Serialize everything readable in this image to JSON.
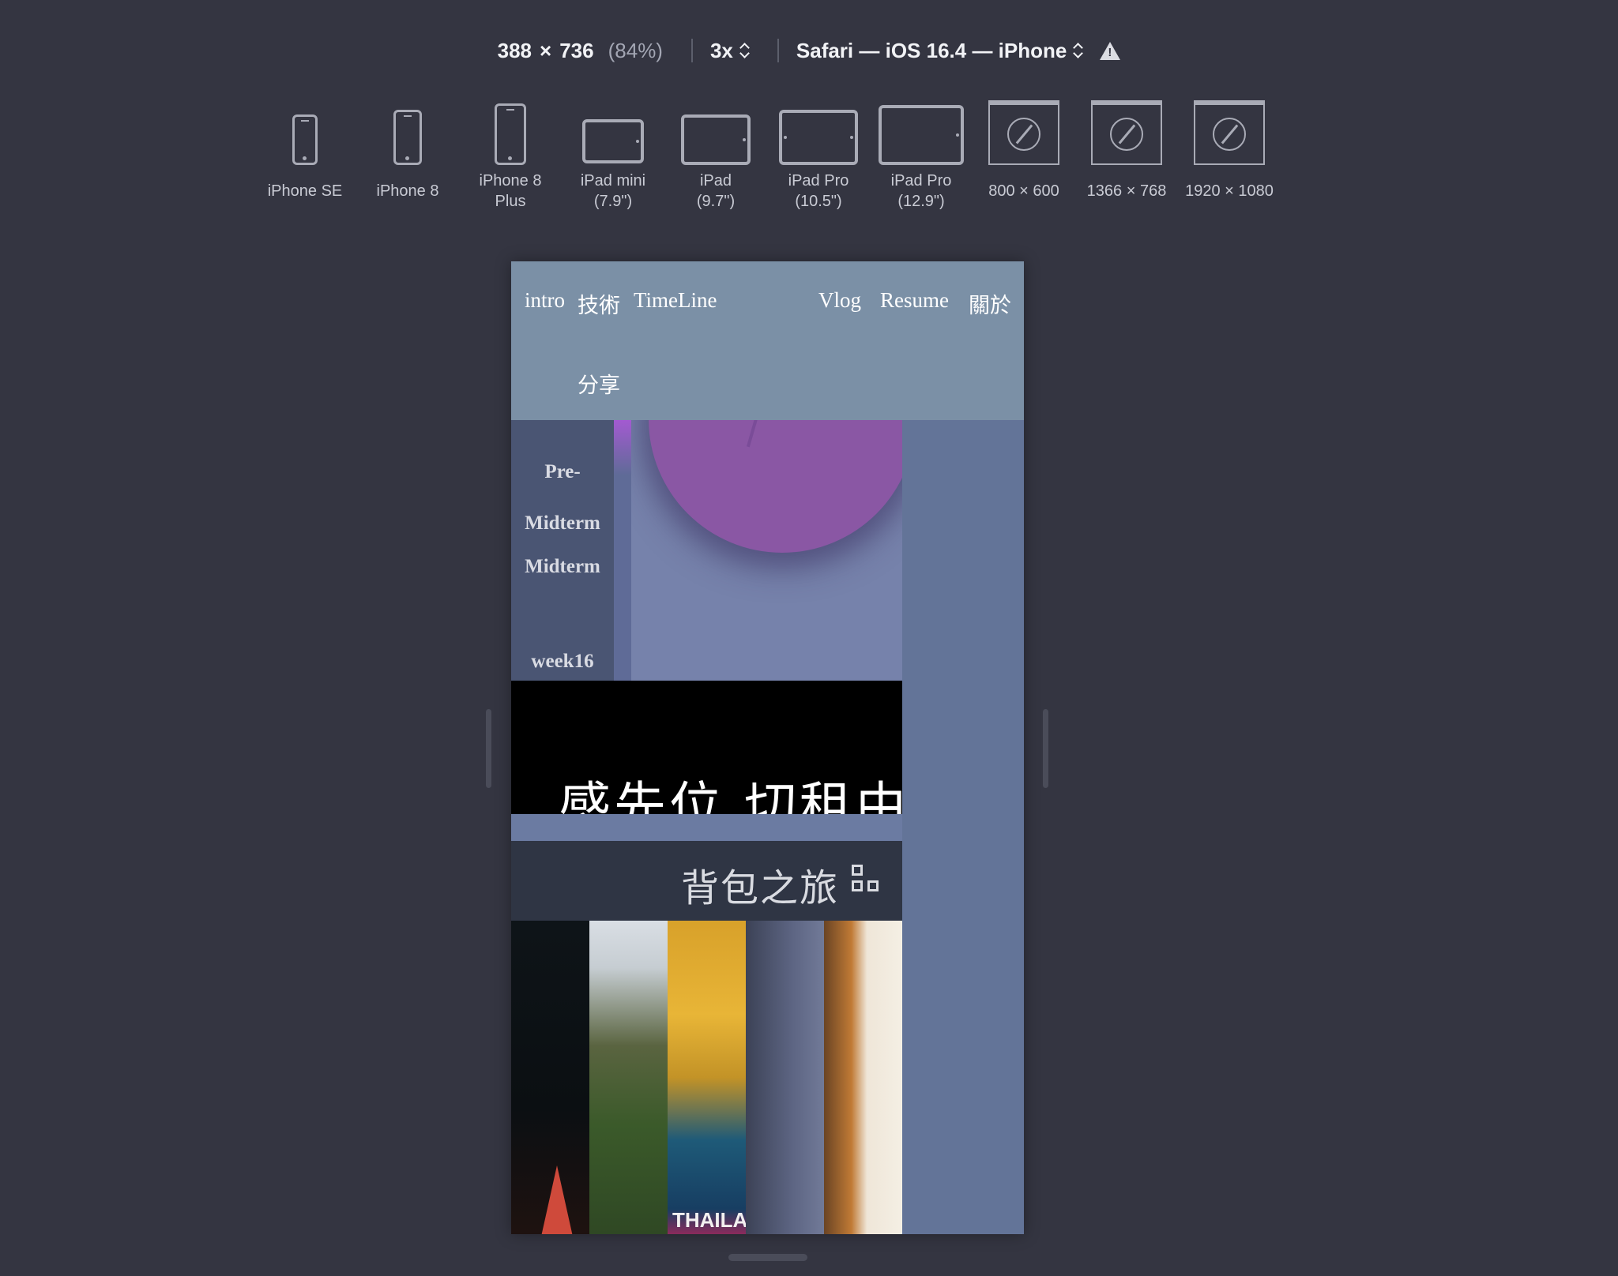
{
  "toolbar": {
    "width": "388",
    "times": "×",
    "height": "736",
    "zoom": "(84%)",
    "scale": "3x",
    "browser": "Safari — iOS 16.4 — iPhone",
    "warning_icon": "warning-icon"
  },
  "devices": [
    {
      "label": "iPhone SE",
      "icon": "phone-icon"
    },
    {
      "label": "iPhone 8",
      "icon": "phone-icon"
    },
    {
      "label": "iPhone 8\nPlus",
      "icon": "phone-icon"
    },
    {
      "label": "iPad mini\n(7.9\")",
      "icon": "tablet-icon"
    },
    {
      "label": "iPad\n(9.7\")",
      "icon": "tablet-icon"
    },
    {
      "label": "iPad Pro\n(10.5\")",
      "icon": "tablet-icon"
    },
    {
      "label": "iPad Pro\n(12.9\")",
      "icon": "tablet-icon"
    },
    {
      "label": "800 × 600",
      "icon": "browser-icon"
    },
    {
      "label": "1366 × 768",
      "icon": "browser-icon"
    },
    {
      "label": "1920 × 1080",
      "icon": "browser-icon"
    }
  ],
  "site": {
    "nav": {
      "intro": "intro",
      "tech": "技術",
      "timeline": "TimeLine",
      "vlog": "Vlog",
      "resume": "Resume",
      "about": "關於",
      "share": "分享"
    },
    "timeline_items": [
      "Pre-",
      "Midterm",
      "Midterm",
      "week16"
    ],
    "video_caption": "感先位 切租由",
    "section_title": "背包之旅",
    "section_icon": "grid-icon",
    "photo_text": "THAILA"
  }
}
